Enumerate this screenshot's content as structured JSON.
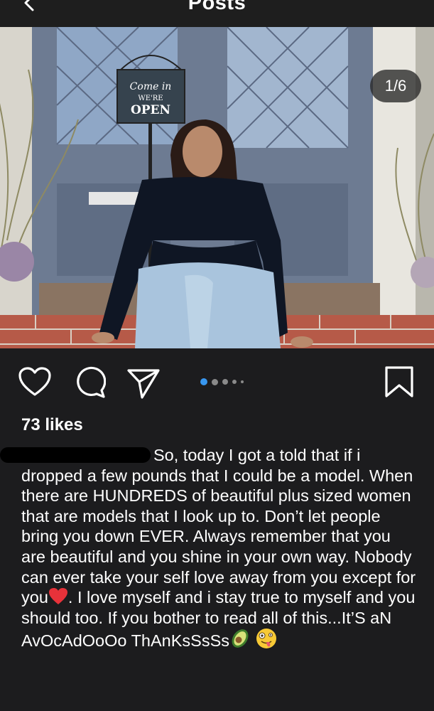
{
  "header": {
    "title": "Posts"
  },
  "post": {
    "image_counter": "1/6",
    "sign_text_1": "Come in",
    "sign_text_2": "WE'RE",
    "sign_text_3": "OPEN",
    "likes": "73 likes",
    "carousel": {
      "count": 5,
      "active_index": 0
    },
    "caption": {
      "text": "So, today I got a told that if i dropped a few pounds that I could be a model. When there are HUNDREDS of beautiful plus sized women that are models that I look up to. Don’t let people bring you down EVER. Always remember that you are beautiful and you shine in your own way. Nobody can ever take your self love away from you except for you",
      "text_2": ". I love myself and i stay true to myself and you should too. If you bother to read all of this...It’S aN AvOcAdOoOo ThAnKsSsSs"
    }
  },
  "icons": [
    "back-icon",
    "heart-icon",
    "comment-icon",
    "share-icon",
    "bookmark-icon",
    "heart-emoji-icon",
    "avocado-emoji-icon",
    "zany-face-emoji-icon"
  ],
  "colors": {
    "background": "#1c1c1e",
    "carousel_active": "#3897f0",
    "accent_red": "#e8323a"
  }
}
